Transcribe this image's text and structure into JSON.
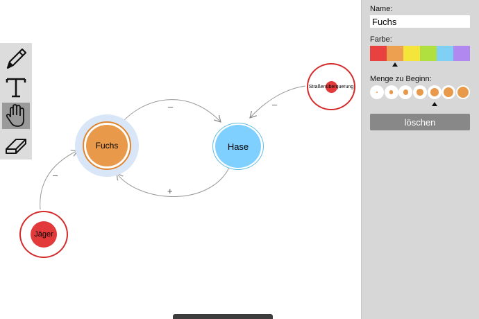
{
  "canvas": {
    "nodes": {
      "fuchs": {
        "label": "Fuchs",
        "color": "#e8994a"
      },
      "hase": {
        "label": "Hase",
        "color": "#7fcfff"
      },
      "jaeger": {
        "label": "Jäger",
        "color": "#e23a3a"
      },
      "strasse": {
        "label": "Straßenüberquerung",
        "color": "#e23a3a"
      }
    },
    "links": {
      "fuchs_to_hase": "–",
      "hase_to_fuchs": "+",
      "jaeger_to_fuchs": "–",
      "strasse_to_hase": "–"
    }
  },
  "toolbar": {
    "tools": [
      {
        "name": "pencil-icon",
        "active": false
      },
      {
        "name": "text-icon",
        "active": false
      },
      {
        "name": "hand-icon",
        "active": true
      },
      {
        "name": "eraser-icon",
        "active": false
      }
    ]
  },
  "panel": {
    "name_label": "Name:",
    "name_value": "Fuchs",
    "color_label": "Farbe:",
    "colors": [
      "#e94040",
      "#eda050",
      "#f5e53a",
      "#b0e040",
      "#80d0f5",
      "#b088f0"
    ],
    "selected_color_index": 1,
    "amount_label": "Menge zu Beginn:",
    "amount_options": 7,
    "selected_amount_index": 4,
    "delete_label": "löschen"
  }
}
